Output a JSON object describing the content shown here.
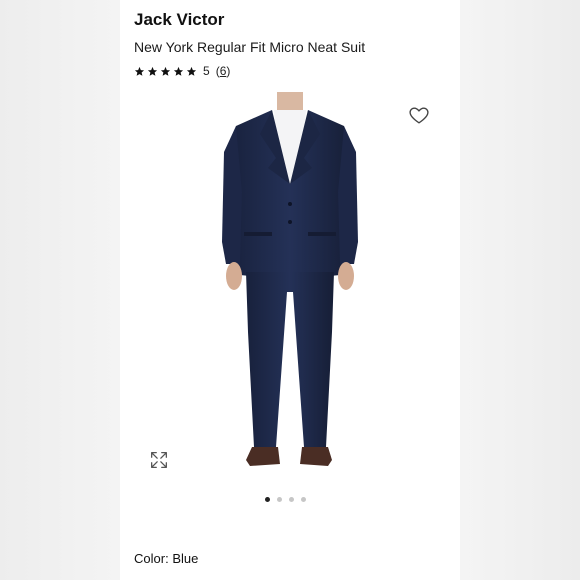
{
  "product": {
    "brand": "Jack Victor",
    "name": "New York Regular Fit Micro Neat Suit",
    "rating": {
      "value": "5",
      "review_count": "6",
      "stars": 5
    },
    "color_label": "Color:",
    "color_value": "Blue"
  },
  "gallery": {
    "image_count": 4,
    "active_index": 0,
    "suit_color": "#1f2a4a"
  },
  "icons": {
    "wishlist": "heart-icon",
    "expand": "expand-icon",
    "rating": "star-icon"
  }
}
